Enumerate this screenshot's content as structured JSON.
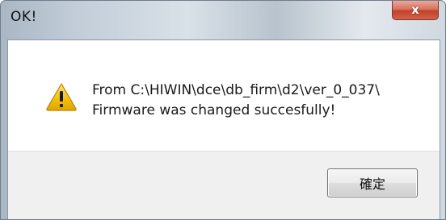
{
  "window": {
    "title": "OK!",
    "close_glyph": "x"
  },
  "dialog": {
    "icon": "warning-icon",
    "message_lines": [
      "From C:\\HIWIN\\dce\\db_firm\\d2\\ver_0_037\\",
      "Firmware was changed succesfully!"
    ],
    "ok_label": "確定"
  },
  "colors": {
    "warning_fill": "#f4c20d",
    "close_button": "#c2412a"
  }
}
